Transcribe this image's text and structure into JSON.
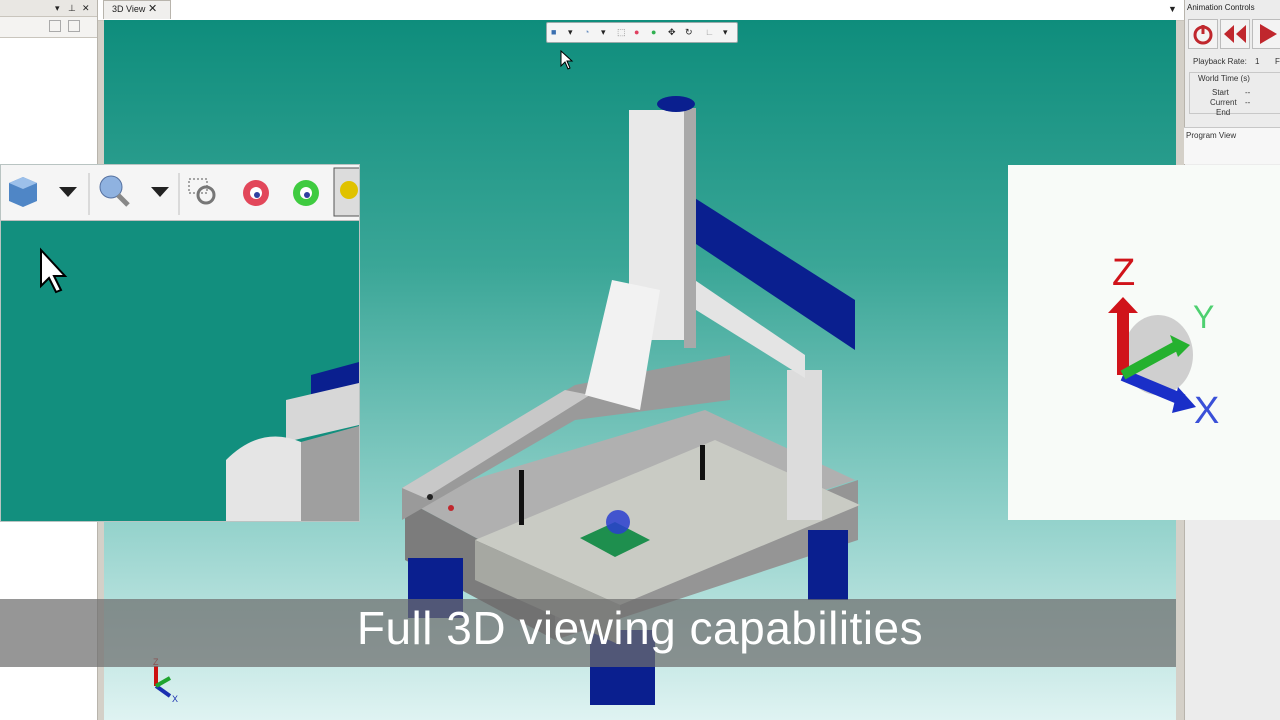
{
  "tabs": [
    {
      "label": "3D View",
      "close": "✕"
    }
  ],
  "left_panel": {
    "pin": "▾ ⊕ ✕"
  },
  "right_panel": {
    "title": "Animation Controls",
    "playback_rate_label": "Playback Rate:",
    "playback_rate_value": "1",
    "playback_rate_suffix": "F",
    "world_time_label": "World Time (s)",
    "start_label": "Start",
    "start_value": "--",
    "current_label": "Current",
    "current_value": "--",
    "end_label": "End",
    "program_view_label": "Program View",
    "buttons": [
      "power-icon",
      "rewind-icon",
      "play-icon"
    ]
  },
  "toolbar_icons": [
    "view-cube-icon",
    "dropdown-arrow-icon",
    "zoom-icon",
    "dropdown-arrow-icon",
    "zoom-window-icon",
    "red-eye-icon",
    "green-eye-icon",
    "pan-icon",
    "rotate-icon",
    "axes-icon",
    "dropdown-arrow-icon"
  ],
  "axis_labels": {
    "z": "Z",
    "y": "Y",
    "x": "X"
  },
  "caption": "Full 3D viewing capabilities",
  "colors": {
    "viewport_top": "#0e8d7c",
    "viewport_bottom": "#dff3f2",
    "machine_blue": "#0a1f8f",
    "machine_gray": "#a9a9a9",
    "play_red": "#c0272d"
  }
}
